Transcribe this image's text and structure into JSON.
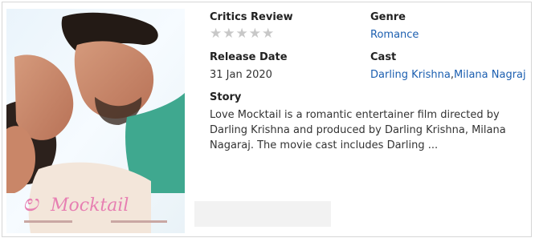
{
  "movie": {
    "poster_title": "Love Mocktail",
    "critics_review": {
      "label": "Critics Review",
      "rating": 0,
      "max": 5
    },
    "genre": {
      "label": "Genre",
      "value": "Romance"
    },
    "release_date": {
      "label": "Release Date",
      "value": "31 Jan 2020"
    },
    "cast": {
      "label": "Cast",
      "names": [
        "Darling Krishna",
        "Milana Nagraj"
      ],
      "separator": ","
    },
    "story": {
      "label": "Story",
      "text": "Love Mocktail is a romantic entertainer film directed by Darling Krishna and produced by Darling Krishna, Milana Nagaraj. The movie cast includes Darling ..."
    }
  },
  "colors": {
    "link": "#1c5fb0",
    "star_empty": "#c8c8c8",
    "border": "#d6d6d6"
  },
  "icons": {
    "star": "star-empty-icon"
  }
}
